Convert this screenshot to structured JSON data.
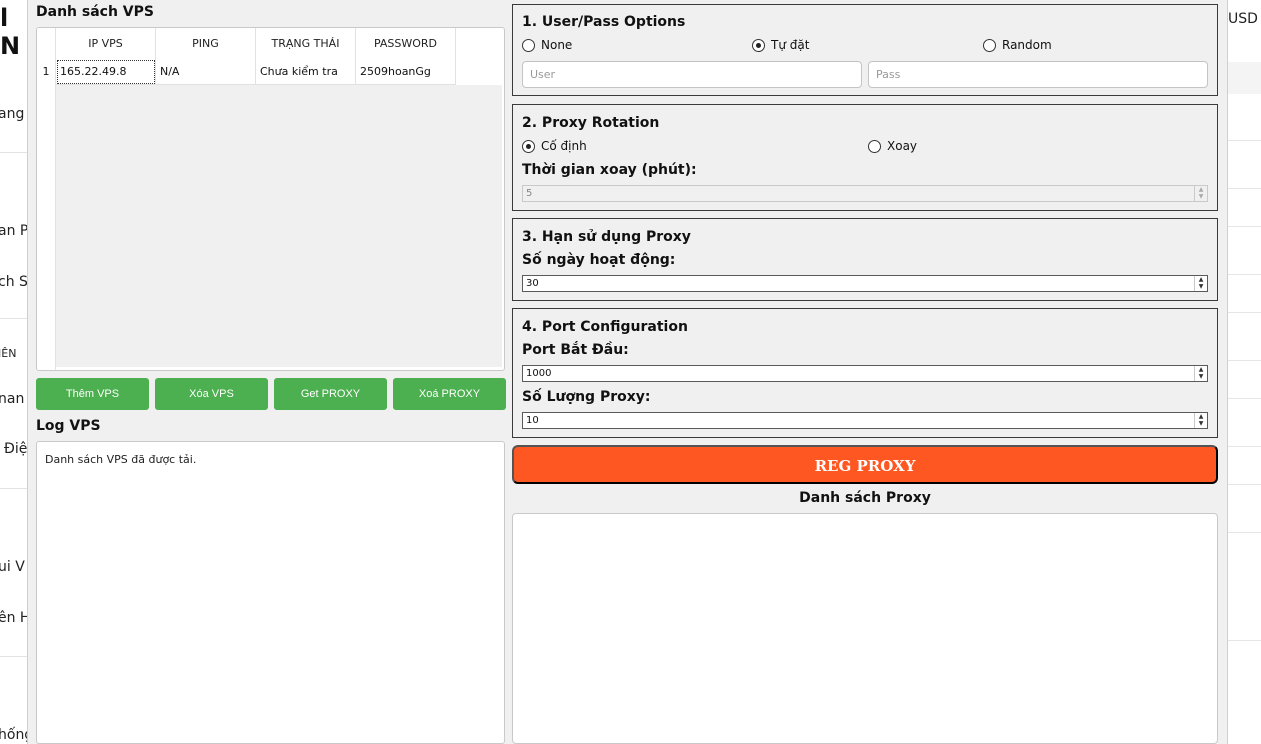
{
  "background": {
    "left_fragments": [
      "ang",
      "an P",
      "ch S",
      "IÊN",
      "nan",
      "Điệ",
      "ui V",
      "ên H",
      "hống"
    ],
    "right_fragment": "USD"
  },
  "vps": {
    "title": "Danh sách VPS",
    "columns": [
      "IP VPS",
      "PING",
      "TRẠNG THÁI",
      "PASSWORD"
    ],
    "rows": [
      {
        "num": "1",
        "ip": "165.22.49.8",
        "ping": "N/A",
        "status": "Chưa kiểm tra",
        "password": "2509hoanGg"
      }
    ],
    "buttons": {
      "add": "Thêm VPS",
      "delete": "Xóa VPS",
      "get_proxy": "Get PROXY",
      "delete_proxy": "Xoá PROXY"
    },
    "button_color": "#4caf50"
  },
  "log": {
    "title": "Log VPS",
    "text": "Danh sách VPS đã được tải."
  },
  "user_pass": {
    "title": "1. User/Pass Options",
    "options": [
      "None",
      "Tự đặt",
      "Random"
    ],
    "selected": "Tự đặt",
    "user_placeholder": "User",
    "pass_placeholder": "Pass"
  },
  "rotation": {
    "title": "2. Proxy Rotation",
    "options": [
      "Cố định",
      "Xoay"
    ],
    "selected": "Cố định",
    "interval_label": "Thời gian xoay (phút):",
    "interval_value": "5"
  },
  "usage": {
    "title": "3. Hạn sử dụng Proxy",
    "days_label": "Số ngày hoạt động:",
    "days_value": "30"
  },
  "port": {
    "title": "4. Port Configuration",
    "start_label": "Port Bắt Đầu:",
    "start_value": "1000",
    "count_label": "Số Lượng Proxy:",
    "count_value": "10"
  },
  "reg_button": {
    "label": "REG PROXY",
    "color": "#ff5722"
  },
  "proxy_list": {
    "title": "Danh sách Proxy"
  }
}
